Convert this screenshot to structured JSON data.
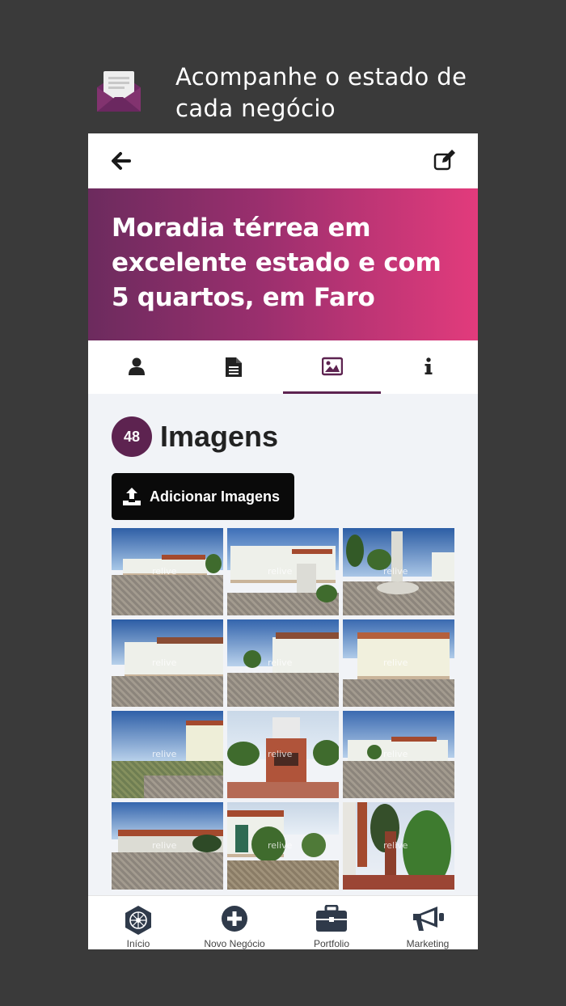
{
  "promo": {
    "line1": "Acompanhe o estado de",
    "line2": "cada negócio",
    "icon": "envelope-letter-icon"
  },
  "colors": {
    "background": "#3a3a3a",
    "accent": "#5d2350",
    "hero_start": "#6c2b5e",
    "hero_end": "#e23b7c"
  },
  "topbar": {
    "back_icon": "arrow-left-icon",
    "edit_icon": "edit-icon"
  },
  "hero": {
    "title": "Moradia térrea em excelente estado e com 5 quartos, em Faro"
  },
  "tabs": [
    {
      "icon": "user-icon",
      "active": false
    },
    {
      "icon": "document-icon",
      "active": false
    },
    {
      "icon": "image-icon",
      "active": true
    },
    {
      "icon": "info-icon",
      "active": false
    }
  ],
  "images_section": {
    "count": "48",
    "title": "Imagens",
    "add_button_label": "Adicionar Imagens",
    "watermark": "relive"
  },
  "bottom_nav": [
    {
      "label": "Início",
      "icon": "home-hexagon-icon"
    },
    {
      "label": "Novo Negócio",
      "icon": "plus-circle-icon"
    },
    {
      "label": "Portfolio",
      "icon": "briefcase-icon"
    },
    {
      "label": "Marketing",
      "icon": "megaphone-icon"
    }
  ]
}
